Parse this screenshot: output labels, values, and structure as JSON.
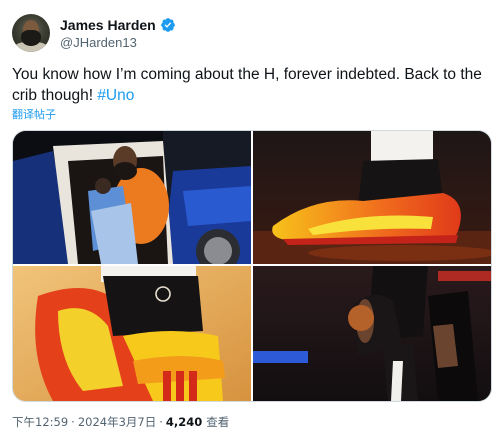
{
  "author": {
    "display_name": "James Harden",
    "handle": "@JHarden13",
    "verified_color": "#1d9bf0"
  },
  "tweet": {
    "text": "You know how I’m coming about the H, forever indebted. Back to the crib though! ",
    "hashtag": "#Uno",
    "translate_label": "翻译帖子"
  },
  "media": [
    {
      "name": "car-photo"
    },
    {
      "name": "sneaker-court-photo"
    },
    {
      "name": "sneaker-closeup-photo"
    },
    {
      "name": "game-action-photo"
    }
  ],
  "meta": {
    "time": "下午12:59",
    "date": "2024年3月7日",
    "separator": "·",
    "views": "4,240",
    "views_label": "查看"
  },
  "colors": {
    "link": "#1d9bf0",
    "secondary_text": "#536471",
    "primary_text": "#0f1419"
  }
}
